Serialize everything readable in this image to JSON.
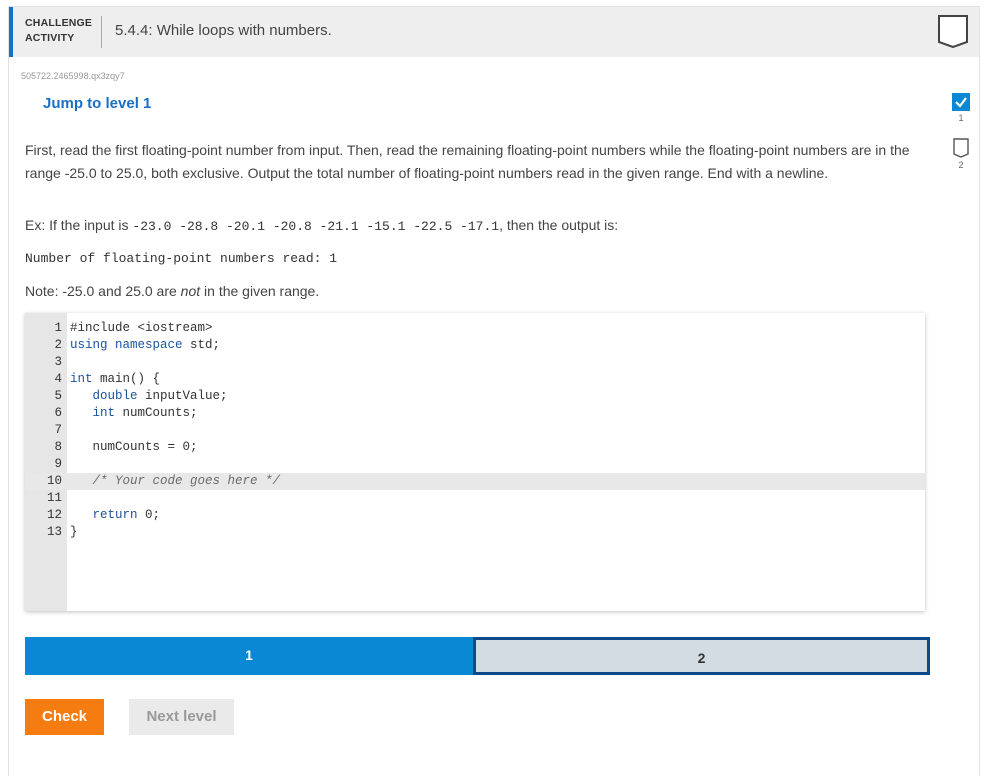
{
  "header": {
    "kind_line1": "CHALLENGE",
    "kind_line2": "ACTIVITY",
    "title": "5.4.4: While loops with numbers."
  },
  "activity_code": "505722.2465998.qx3zqy7",
  "jump_label": "Jump to level 1",
  "instructions": "First, read the first floating-point number from input. Then, read the remaining floating-point numbers while the floating-point numbers are in the range -25.0 to 25.0, both exclusive. Output the total number of floating-point numbers read in the given range. End with a newline.",
  "example": {
    "prefix": "Ex: If the input is ",
    "input": "-23.0 -28.8 -20.1 -20.8 -21.1 -15.1 -22.5 -17.1",
    "suffix": ", then the output is:",
    "output": "Number of floating-point numbers read: 1"
  },
  "note": {
    "prefix": "Note: -25.0 and 25.0 are ",
    "emphasis": "not",
    "suffix": " in the given range."
  },
  "code": {
    "line_numbers": [
      "1",
      "2",
      "3",
      "4",
      "5",
      "6",
      "7",
      "8",
      "9",
      "10",
      "11",
      "12",
      "13"
    ],
    "lines": [
      "#include <iostream>",
      "using namespace std;",
      "",
      "int main() {",
      "   double inputValue;",
      "   int numCounts;",
      "",
      "   numCounts = 0;",
      "",
      "   /* Your code goes here */",
      "",
      "   return 0;",
      "}"
    ],
    "active_line": 10
  },
  "levels": [
    {
      "label": "1",
      "state": "current"
    },
    {
      "label": "2",
      "state": "locked"
    }
  ],
  "buttons": {
    "check": "Check",
    "next": "Next level"
  },
  "side_levels": [
    {
      "num": "1",
      "done": true
    },
    {
      "num": "2",
      "done": false
    }
  ],
  "colors": {
    "accent_blue": "#0a88d4",
    "check_orange": "#f47c10",
    "level2_border": "#0c4a8a"
  }
}
